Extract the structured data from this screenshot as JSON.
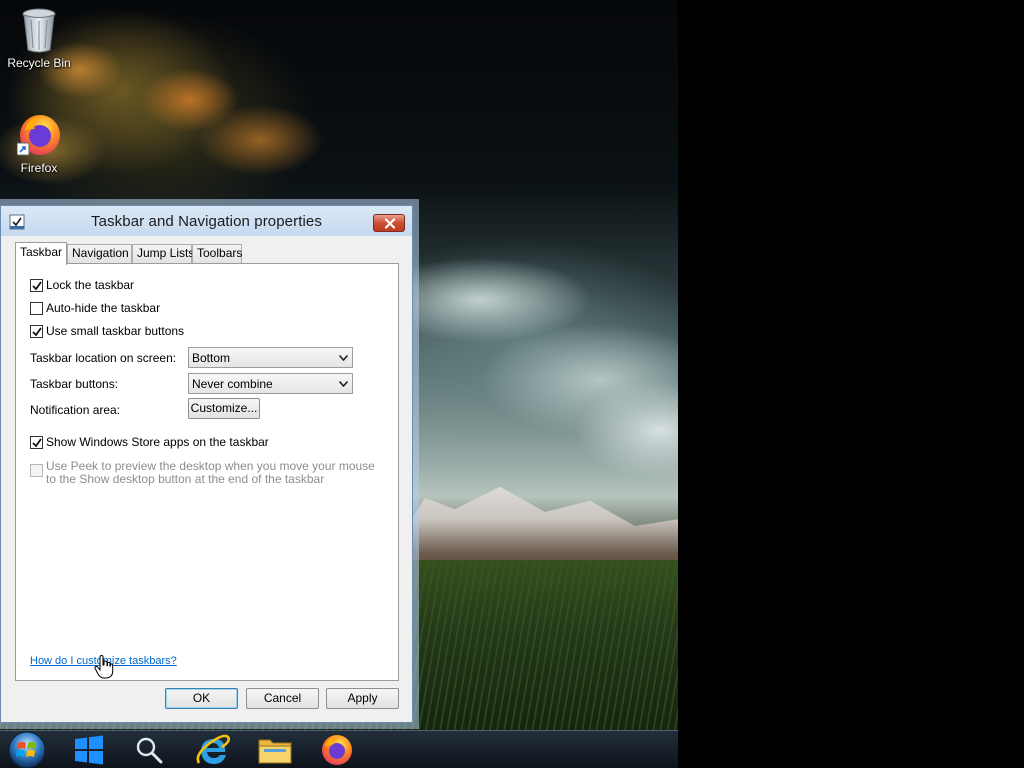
{
  "desktop": {
    "icons": [
      {
        "label": "Recycle Bin",
        "icon": "recycle-bin-icon"
      },
      {
        "label": "Firefox",
        "icon": "firefox-icon"
      }
    ]
  },
  "dialog": {
    "title": "Taskbar and Navigation properties",
    "close_icon": "close-icon",
    "tabs": [
      {
        "label": "Taskbar",
        "active": true
      },
      {
        "label": "Navigation",
        "active": false
      },
      {
        "label": "Jump Lists",
        "active": false
      },
      {
        "label": "Toolbars",
        "active": false
      }
    ],
    "options": {
      "lock_taskbar": {
        "label": "Lock the taskbar",
        "checked": true
      },
      "auto_hide": {
        "label": "Auto-hide the taskbar",
        "checked": false
      },
      "small_buttons": {
        "label": "Use small taskbar buttons",
        "checked": true
      },
      "location": {
        "label": "Taskbar location on screen:",
        "value": "Bottom"
      },
      "buttons": {
        "label": "Taskbar buttons:",
        "value": "Never combine"
      },
      "notification": {
        "label": "Notification area:",
        "button": "Customize..."
      },
      "store_apps": {
        "label": "Show Windows Store apps on the taskbar",
        "checked": true
      },
      "peek": {
        "label": "Use Peek to preview the desktop when you move your mouse to the Show desktop button at the end of the taskbar",
        "checked": false,
        "disabled": true
      }
    },
    "help_link": "How do I customize taskbars?",
    "footer": {
      "ok": "OK",
      "cancel": "Cancel",
      "apply": "Apply"
    }
  },
  "taskbar": {
    "items": [
      "start-orb-icon",
      "windows-logo-icon",
      "search-icon",
      "internet-explorer-icon",
      "file-explorer-icon",
      "firefox-icon"
    ]
  },
  "colors": {
    "titlebar": "#c5d9ef",
    "close_button": "#cc4e33",
    "link": "#0066cc",
    "default_button_border": "#3c7fb1"
  }
}
